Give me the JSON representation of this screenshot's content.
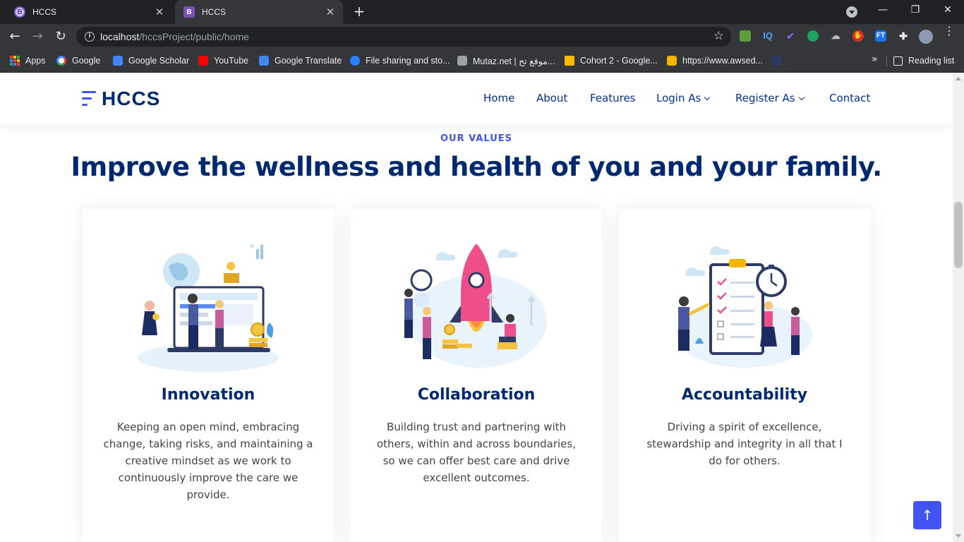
{
  "browser": {
    "tabs": [
      {
        "title": "HCCS",
        "favicon": "B"
      },
      {
        "title": "HCCS",
        "favicon": "B"
      }
    ],
    "new_tab": "+",
    "url": {
      "host": "localhost",
      "path": "/hccsProject/public/home"
    },
    "bookmarks": [
      {
        "label": "Apps",
        "icon": "apps-grid-icon"
      },
      {
        "label": "Google",
        "icon": "google-icon"
      },
      {
        "label": "Google Scholar",
        "icon": "google-scholar-icon"
      },
      {
        "label": "YouTube",
        "icon": "youtube-icon"
      },
      {
        "label": "Google Translate",
        "icon": "google-translate-icon"
      },
      {
        "label": "File sharing and sto...",
        "icon": "file-sharing-icon"
      },
      {
        "label": "Mutaz.net | موقع تح...",
        "icon": "mutaz-icon"
      },
      {
        "label": "Cohort 2 - Google...",
        "icon": "google-drive-icon"
      },
      {
        "label": "https://www.awsed...",
        "icon": "package-icon"
      }
    ],
    "bookmarks_more": "»",
    "reading_list": "Reading list"
  },
  "site": {
    "logo": "HCCS",
    "nav": {
      "home": "Home",
      "about": "About",
      "features": "Features",
      "login": "Login As",
      "register": "Register As",
      "contact": "Contact"
    }
  },
  "values": {
    "eyebrow": "OUR VALUES",
    "headline": "Improve the wellness and health of you and your family.",
    "cards": [
      {
        "title": "Innovation",
        "text": "Keeping an open mind, embracing change, taking risks, and maintaining a creative mindset as we work to continuously improve the care we provide."
      },
      {
        "title": "Collaboration",
        "text": "Building trust and partnering with others, within and across boundaries, so we can offer best care and drive excellent outcomes."
      },
      {
        "title": "Accountability",
        "text": "Driving a spirit of excellence, stewardship and integrity in all that I do for others."
      }
    ]
  },
  "back_to_top": "↑",
  "colors": {
    "brand": "#012970",
    "accent": "#4154f1"
  }
}
